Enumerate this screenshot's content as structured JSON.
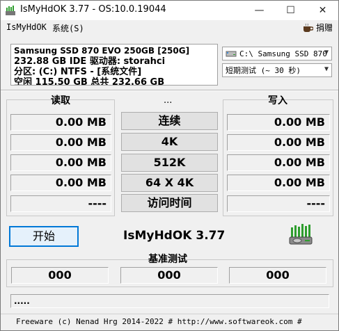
{
  "window": {
    "title": "IsMyHdOK 3.77 - OS:10.0.19044"
  },
  "menu": {
    "file": "IsMyHdOK",
    "system": "系统(S)",
    "donate": "捐赠"
  },
  "info": {
    "lines": [
      "Samsung SSD 870 EVO 250GB [250G]",
      "232.88 GB  IDE 驱动器: storahci",
      "分区: (C:) NTFS - [系统文件]",
      "空闲 115.50 GB 总共 232.66 GB"
    ]
  },
  "drive_select": {
    "value": "C:\\ Samsung SSD 870"
  },
  "mode_select": {
    "value": "短期测试 (~ 30 秒)"
  },
  "labels": {
    "read": "读取",
    "mid": "...",
    "write": "写入",
    "benchmark": "基准测试"
  },
  "tests": [
    {
      "label": "连续",
      "read": "0.00 MB",
      "write": "0.00 MB"
    },
    {
      "label": "4K",
      "read": "0.00 MB",
      "write": "0.00 MB"
    },
    {
      "label": "512K",
      "read": "0.00 MB",
      "write": "0.00 MB"
    },
    {
      "label": "64 X 4K",
      "read": "0.00 MB",
      "write": "0.00 MB"
    },
    {
      "label": "访问时间",
      "read": "----",
      "write": "----"
    }
  ],
  "start_button": "开始",
  "app_name": "IsMyHdOK 3.77",
  "benchmark_values": [
    "000",
    "000",
    "000"
  ],
  "status_text": ".....",
  "footer": "Freeware (c) Nenad Hrg 2014-2022 # http://www.softwareok.com    #",
  "colors": {
    "accent": "#0078d7",
    "logo_green": "#2e9e2e"
  }
}
